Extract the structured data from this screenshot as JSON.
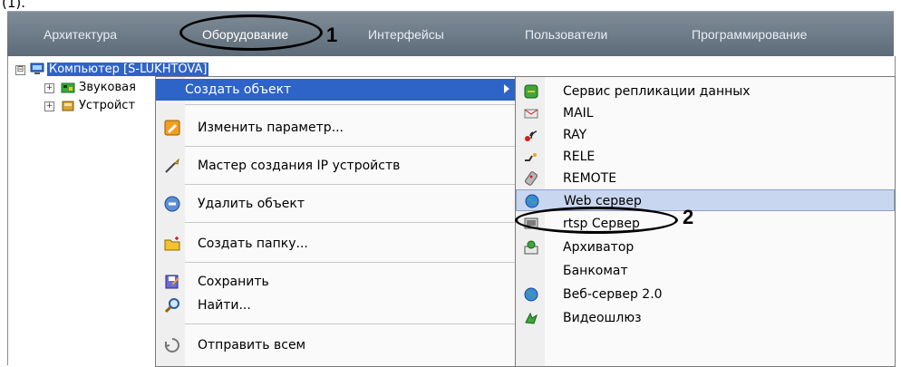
{
  "caption": "(1).",
  "tabs": [
    {
      "label": "Архитектура"
    },
    {
      "label": "Оборудование"
    },
    {
      "label": "Интерфейсы"
    },
    {
      "label": "Пользователи"
    },
    {
      "label": "Программирование"
    }
  ],
  "annotations": {
    "marker1": "1",
    "marker2": "2"
  },
  "tree": {
    "root": {
      "label": "Компьютер [S-LUKHTOVA]",
      "expander": "⊟"
    },
    "children": [
      {
        "label": "Звуковая",
        "expander": "+"
      },
      {
        "label": "Устройст",
        "expander": "+"
      }
    ]
  },
  "context_menu": {
    "items": [
      {
        "label": "Создать объект",
        "icon": "none",
        "has_submenu": true,
        "highlighted": true
      },
      {
        "label": "Изменить параметр...",
        "icon": "edit-param-icon"
      },
      {
        "label": "Мастер создания IP устройств",
        "icon": "wizard-icon"
      },
      {
        "label": "Удалить объект",
        "icon": "delete-icon"
      },
      {
        "label": "Создать папку...",
        "icon": "new-folder-icon"
      },
      {
        "label": "Сохранить",
        "icon": "save-icon"
      },
      {
        "label": "Найти...",
        "icon": "find-icon"
      },
      {
        "label": "Отправить всем",
        "icon": "send-all-icon"
      }
    ]
  },
  "submenu": {
    "items": [
      {
        "label": "Сервис репликации данных",
        "icon": "replication-icon"
      },
      {
        "label": "MAIL",
        "icon": "mail-icon"
      },
      {
        "label": "RAY",
        "icon": "ray-icon"
      },
      {
        "label": "RELE",
        "icon": "rele-icon"
      },
      {
        "label": "REMOTE",
        "icon": "remote-icon"
      },
      {
        "label": "Web сервер",
        "icon": "globe-icon",
        "highlighted": true
      },
      {
        "label": "rtsp Сервер",
        "icon": "rtsp-icon"
      },
      {
        "label": "Архиватор",
        "icon": "archiver-icon"
      },
      {
        "label": "Банкомат",
        "icon": "none"
      },
      {
        "label": "Веб-сервер 2.0",
        "icon": "globe-icon"
      },
      {
        "label": "Видеошлюз",
        "icon": "video-gateway-icon"
      }
    ]
  }
}
